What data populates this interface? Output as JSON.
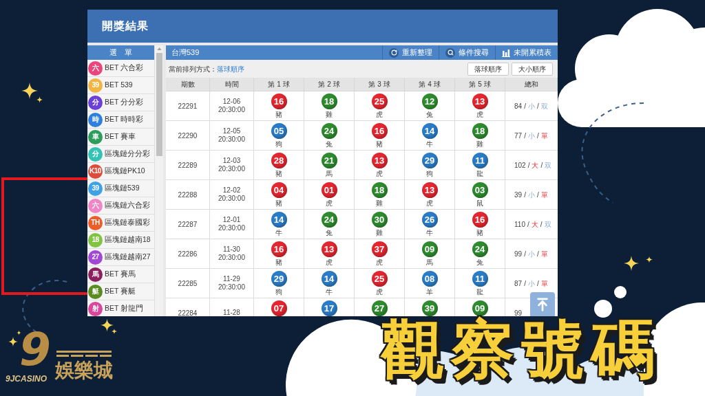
{
  "window": {
    "title": "開獎結果"
  },
  "sidebar": {
    "header": "選　單",
    "items": [
      {
        "badge": "六",
        "label": "BET 六合彩",
        "color": "#e8467c"
      },
      {
        "badge": "39",
        "label": "BET 539",
        "color": "#f2b544"
      },
      {
        "badge": "分",
        "label": "BET 分分彩",
        "color": "#6c3fd6"
      },
      {
        "badge": "時",
        "label": "BET 時時彩",
        "color": "#2f7fdc"
      },
      {
        "badge": "車",
        "label": "BET 賽車",
        "color": "#2e9d5c"
      },
      {
        "badge": "分",
        "label": "區塊鏈分分彩",
        "color": "#35c2b5"
      },
      {
        "badge": "K10",
        "label": "區塊鏈PK10",
        "color": "#dd4b39"
      },
      {
        "badge": "39",
        "label": "區塊鏈539",
        "color": "#3fa2e6"
      },
      {
        "badge": "六",
        "label": "區塊鏈六合彩",
        "color": "#ee86c8"
      },
      {
        "badge": "TH",
        "label": "區塊鏈泰國彩",
        "color": "#ec5d2a"
      },
      {
        "badge": "18",
        "label": "區塊鏈越南18",
        "color": "#82c341"
      },
      {
        "badge": "27",
        "label": "區塊鏈越南27",
        "color": "#a347d6"
      },
      {
        "badge": "馬",
        "label": "BET 賽馬",
        "color": "#8c1f5e"
      },
      {
        "badge": "艇",
        "label": "BET 賽艇",
        "color": "#5b8c22"
      },
      {
        "badge": "射",
        "label": "BET 射龍門",
        "color": "#d8479c"
      }
    ]
  },
  "toolbar": {
    "title": "台灣539",
    "actions": [
      {
        "kind": "refresh",
        "label": "重新整理"
      },
      {
        "kind": "search",
        "label": "條件搜尋"
      },
      {
        "kind": "chart",
        "label": "未開累積表"
      }
    ]
  },
  "sort": {
    "label": "當前排列方式：",
    "current": "落球順序",
    "buttons": [
      "落球順序",
      "大小順序"
    ]
  },
  "table": {
    "columns": [
      "期數",
      "時間",
      "第 1 球",
      "第 2 球",
      "第 3 球",
      "第 4 球",
      "第 5 球",
      "總和"
    ],
    "rows": [
      {
        "issue": "22291",
        "date": "12-06",
        "time": "20:30:00",
        "balls": [
          {
            "number": "16",
            "color": "#e3262f",
            "zodiac": "豬"
          },
          {
            "number": "18",
            "color": "#2e8b2e",
            "zodiac": "雞"
          },
          {
            "number": "25",
            "color": "#e3262f",
            "zodiac": "虎"
          },
          {
            "number": "12",
            "color": "#2e8b2e",
            "zodiac": "兔"
          },
          {
            "number": "13",
            "color": "#e3262f",
            "zodiac": "虎"
          }
        ],
        "sum": [
          {
            "kind": "total",
            "text": "84"
          },
          {
            "kind": "slash",
            "text": "/"
          },
          {
            "kind": "small",
            "text": "小"
          },
          {
            "kind": "slash",
            "text": "/"
          },
          {
            "kind": "even",
            "text": "双"
          }
        ]
      },
      {
        "issue": "22290",
        "date": "12-05",
        "time": "20:30:00",
        "balls": [
          {
            "number": "05",
            "color": "#2b7cc7",
            "zodiac": "狗"
          },
          {
            "number": "24",
            "color": "#2e8b2e",
            "zodiac": "兔"
          },
          {
            "number": "16",
            "color": "#e3262f",
            "zodiac": "豬"
          },
          {
            "number": "14",
            "color": "#2b7cc7",
            "zodiac": "牛"
          },
          {
            "number": "18",
            "color": "#2e8b2e",
            "zodiac": "雞"
          }
        ],
        "sum": [
          {
            "kind": "total",
            "text": "77"
          },
          {
            "kind": "slash",
            "text": "/"
          },
          {
            "kind": "small",
            "text": "小"
          },
          {
            "kind": "slash",
            "text": "/"
          },
          {
            "kind": "odd",
            "text": "單"
          }
        ]
      },
      {
        "issue": "22289",
        "date": "12-03",
        "time": "20:30:00",
        "balls": [
          {
            "number": "28",
            "color": "#e3262f",
            "zodiac": "豬"
          },
          {
            "number": "21",
            "color": "#2e8b2e",
            "zodiac": "馬"
          },
          {
            "number": "13",
            "color": "#e3262f",
            "zodiac": "虎"
          },
          {
            "number": "29",
            "color": "#2b7cc7",
            "zodiac": "狗"
          },
          {
            "number": "11",
            "color": "#2b7cc7",
            "zodiac": "龍"
          }
        ],
        "sum": [
          {
            "kind": "total",
            "text": "102"
          },
          {
            "kind": "slash",
            "text": "/"
          },
          {
            "kind": "big",
            "text": "大"
          },
          {
            "kind": "slash",
            "text": "/"
          },
          {
            "kind": "even",
            "text": "双"
          }
        ]
      },
      {
        "issue": "22288",
        "date": "12-02",
        "time": "20:30:00",
        "balls": [
          {
            "number": "04",
            "color": "#e3262f",
            "zodiac": "豬"
          },
          {
            "number": "01",
            "color": "#e3262f",
            "zodiac": "虎"
          },
          {
            "number": "18",
            "color": "#2e8b2e",
            "zodiac": "雞"
          },
          {
            "number": "13",
            "color": "#e3262f",
            "zodiac": "虎"
          },
          {
            "number": "03",
            "color": "#2e8b2e",
            "zodiac": "鼠"
          }
        ],
        "sum": [
          {
            "kind": "total",
            "text": "39"
          },
          {
            "kind": "slash",
            "text": "/"
          },
          {
            "kind": "small",
            "text": "小"
          },
          {
            "kind": "slash",
            "text": "/"
          },
          {
            "kind": "odd",
            "text": "單"
          }
        ]
      },
      {
        "issue": "22287",
        "date": "12-01",
        "time": "20:30:00",
        "balls": [
          {
            "number": "14",
            "color": "#2b7cc7",
            "zodiac": "牛"
          },
          {
            "number": "24",
            "color": "#2e8b2e",
            "zodiac": "兔"
          },
          {
            "number": "30",
            "color": "#2e8b2e",
            "zodiac": "雞"
          },
          {
            "number": "26",
            "color": "#2b7cc7",
            "zodiac": "牛"
          },
          {
            "number": "16",
            "color": "#e3262f",
            "zodiac": "豬"
          }
        ],
        "sum": [
          {
            "kind": "total",
            "text": "110"
          },
          {
            "kind": "slash",
            "text": "/"
          },
          {
            "kind": "big",
            "text": "大"
          },
          {
            "kind": "slash",
            "text": "/"
          },
          {
            "kind": "even",
            "text": "双"
          }
        ]
      },
      {
        "issue": "22286",
        "date": "11-30",
        "time": "20:30:00",
        "balls": [
          {
            "number": "16",
            "color": "#e3262f",
            "zodiac": "豬"
          },
          {
            "number": "13",
            "color": "#e3262f",
            "zodiac": "虎"
          },
          {
            "number": "37",
            "color": "#e3262f",
            "zodiac": "虎"
          },
          {
            "number": "09",
            "color": "#2e8b2e",
            "zodiac": "馬"
          },
          {
            "number": "24",
            "color": "#2e8b2e",
            "zodiac": "兔"
          }
        ],
        "sum": [
          {
            "kind": "total",
            "text": "99"
          },
          {
            "kind": "slash",
            "text": "/"
          },
          {
            "kind": "small",
            "text": "小"
          },
          {
            "kind": "slash",
            "text": "/"
          },
          {
            "kind": "odd",
            "text": "單"
          }
        ]
      },
      {
        "issue": "22285",
        "date": "11-29",
        "time": "20:30:00",
        "balls": [
          {
            "number": "29",
            "color": "#2b7cc7",
            "zodiac": "狗"
          },
          {
            "number": "14",
            "color": "#2b7cc7",
            "zodiac": "牛"
          },
          {
            "number": "25",
            "color": "#e3262f",
            "zodiac": "虎"
          },
          {
            "number": "08",
            "color": "#2b7cc7",
            "zodiac": "羊"
          },
          {
            "number": "11",
            "color": "#2b7cc7",
            "zodiac": "龍"
          }
        ],
        "sum": [
          {
            "kind": "total",
            "text": "87"
          },
          {
            "kind": "slash",
            "text": "/"
          },
          {
            "kind": "small",
            "text": "小"
          },
          {
            "kind": "slash",
            "text": "/"
          },
          {
            "kind": "odd",
            "text": "單"
          }
        ]
      },
      {
        "issue": "22284",
        "date": "11-28",
        "balls": [
          {
            "number": "07",
            "color": "#e3262f"
          },
          {
            "number": "17",
            "color": "#2b7cc7"
          },
          {
            "number": "27",
            "color": "#2e8b2e"
          },
          {
            "number": "39",
            "color": "#2e8b2e"
          },
          {
            "number": "09",
            "color": "#2e8b2e"
          }
        ],
        "sum": [
          {
            "kind": "total",
            "text": "99"
          }
        ]
      }
    ]
  },
  "headline": "觀察號碼",
  "logo": {
    "numeral": "9",
    "wordmark": "9JCASINO",
    "name": "娛樂城"
  }
}
